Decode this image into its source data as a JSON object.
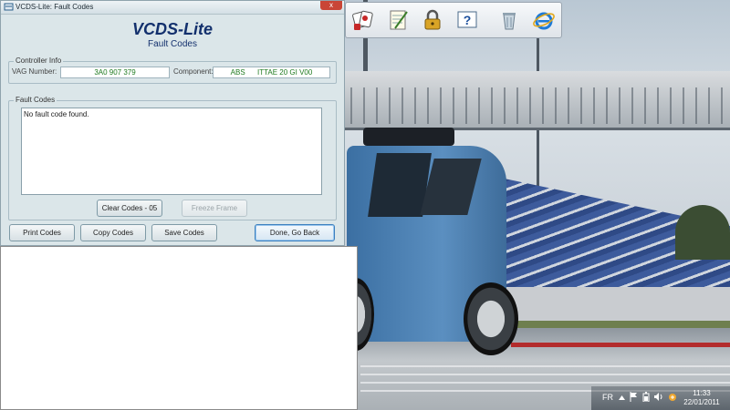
{
  "window": {
    "title": "VCDS-Lite: Fault Codes",
    "close_glyph": "x",
    "app_name": "VCDS-Lite",
    "subtitle": "Fault Codes"
  },
  "controller_info": {
    "group_label": "Controller Info",
    "vag_label": "VAG Number:",
    "vag_value": "3A0 907 379",
    "component_label": "Component:",
    "component_value": "ABS      ITTAE 20 GI V00"
  },
  "fault_codes": {
    "group_label": "Fault Codes",
    "message": "No fault code found."
  },
  "buttons": {
    "clear_codes": "Clear Codes - 05",
    "freeze_frame": "Freeze Frame",
    "print_codes": "Print Codes",
    "copy_codes": "Copy Codes",
    "save_codes": "Save Codes",
    "done": "Done, Go Back"
  },
  "iconbar": {
    "icons": [
      "cards-icon",
      "notepad-icon",
      "padlock-icon",
      "help-icon",
      "recycle-bin-icon",
      "internet-explorer-icon"
    ],
    "help_glyph": "?"
  },
  "tray": {
    "language": "FR",
    "time": "11:33",
    "date": "22/01/2011"
  },
  "colors": {
    "window_bg": "#dbe6e9",
    "title_blue": "#13306d",
    "value_green": "#1f7a1f",
    "close_red": "#c94637"
  }
}
